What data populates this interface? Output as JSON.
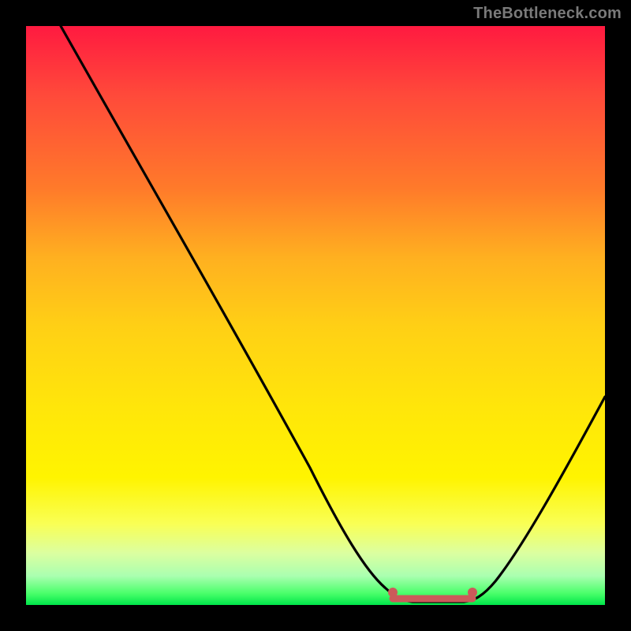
{
  "watermark": "TheBottleneck.com",
  "chart_data": {
    "type": "line",
    "title": "",
    "xlabel": "",
    "ylabel": "",
    "xlim": [
      0,
      100
    ],
    "ylim": [
      0,
      100
    ],
    "grid": false,
    "legend": false,
    "background": "heatmap-gradient-red-yellow-green-vertical",
    "series": [
      {
        "name": "bottleneck-curve",
        "x": [
          6,
          15,
          25,
          35,
          45,
          55,
          61,
          63,
          65,
          70,
          75,
          77,
          79,
          85,
          92,
          100
        ],
        "y": [
          100,
          86,
          71,
          56,
          41,
          26,
          12,
          6,
          2,
          0,
          0,
          2,
          5,
          14,
          26,
          41
        ]
      }
    ],
    "markers": [
      {
        "name": "left-flat-endpoint",
        "x": 63,
        "y": 3,
        "color": "#cc5a5a",
        "size": 6
      },
      {
        "name": "right-flat-endpoint",
        "x": 77,
        "y": 3,
        "color": "#cc5a5a",
        "size": 6
      }
    ],
    "flat_segment": {
      "x_from": 63,
      "x_to": 77,
      "y": 1,
      "color": "#cc5a5a",
      "thickness": 7
    }
  }
}
